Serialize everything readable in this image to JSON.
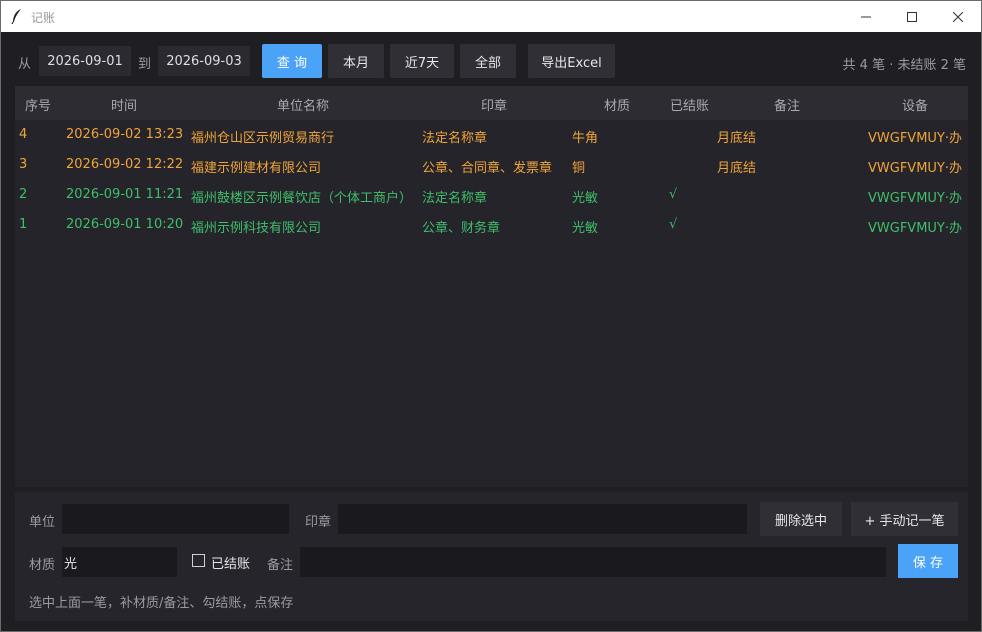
{
  "window": {
    "title": "记账"
  },
  "toolbar": {
    "from_label": "从",
    "from_date": "2026-09-01",
    "to_label": "到",
    "to_date": "2026-09-03",
    "query_label": "查 询",
    "this_month_label": "本月",
    "last7_label": "近7天",
    "all_label": "全部",
    "export_label": "导出Excel",
    "summary": "共 4 笔 · 未结账 2 笔"
  },
  "table": {
    "headers": [
      "序号",
      "时间",
      "单位名称",
      "印章",
      "材质",
      "已结账",
      "备注",
      "设备"
    ],
    "rows": [
      {
        "no": "4",
        "time": "2026-09-02 13:23",
        "unit": "福州仓山区示例贸易商行",
        "seal": "法定名称章",
        "material": "牛角",
        "settled": "",
        "note": "月底结",
        "device": "VWGFVMUY·办"
      },
      {
        "no": "3",
        "time": "2026-09-02 12:22",
        "unit": "福建示例建材有限公司",
        "seal": "公章、合同章、发票章",
        "material": "铜",
        "settled": "",
        "note": "月底结",
        "device": "VWGFVMUY·办"
      },
      {
        "no": "2",
        "time": "2026-09-01 11:21",
        "unit": "福州鼓楼区示例餐饮店（个体工商户）",
        "seal": "法定名称章",
        "material": "光敏",
        "settled": "√",
        "note": "",
        "device": "VWGFVMUY·办"
      },
      {
        "no": "1",
        "time": "2026-09-01 10:20",
        "unit": "福州示例科技有限公司",
        "seal": "公章、财务章",
        "material": "光敏",
        "settled": "√",
        "note": "",
        "device": "VWGFVMUY·办"
      }
    ]
  },
  "form": {
    "unit_label": "单位",
    "unit_value": "",
    "seal_label": "印章",
    "seal_value": "",
    "delete_label": "删除选中",
    "manual_add_label": "+ 手动记一笔",
    "material_label": "材质",
    "material_value": "光",
    "settled_label": "已结账",
    "settled_checked": false,
    "note_label": "备注",
    "note_value": "",
    "save_label": "保 存",
    "hint": "选中上面一笔，补材质/备注、勾结账，点保存"
  },
  "colors": {
    "unsettled": "#f0a43a",
    "settled": "#3fbf6a",
    "accent": "#4ba3f7"
  },
  "icons": [
    "feather-icon",
    "minimize-icon",
    "maximize-icon",
    "close-icon"
  ]
}
